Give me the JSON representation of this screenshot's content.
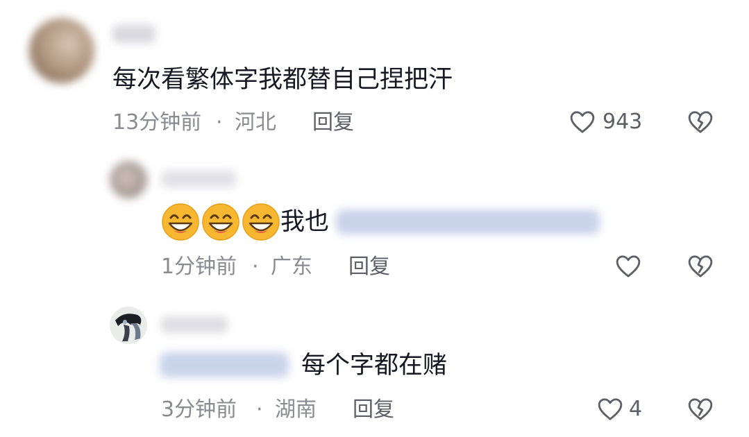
{
  "comments": [
    {
      "text": "每次看繁体字我都替自己捏把汗",
      "time": "13分钟前",
      "sep": "·",
      "location": "河北",
      "reply_label": "回复",
      "likes": "943"
    },
    {
      "text": "我也",
      "time": "1分钟前",
      "sep": "·",
      "location": "广东",
      "reply_label": "回复",
      "likes": ""
    },
    {
      "text": "每个字都在赌",
      "time": "3分钟前",
      "sep": "·",
      "location": "湖南",
      "reply_label": "回复",
      "likes": "4"
    }
  ],
  "icons": {
    "like": "heart-outline-icon",
    "dislike": "broken-heart-icon",
    "emoji": "grinning-face-emoji"
  },
  "colors": {
    "text": "#161823",
    "meta": "#8a8b91",
    "icon": "#5d5e66",
    "emoji": "#f7b731"
  }
}
